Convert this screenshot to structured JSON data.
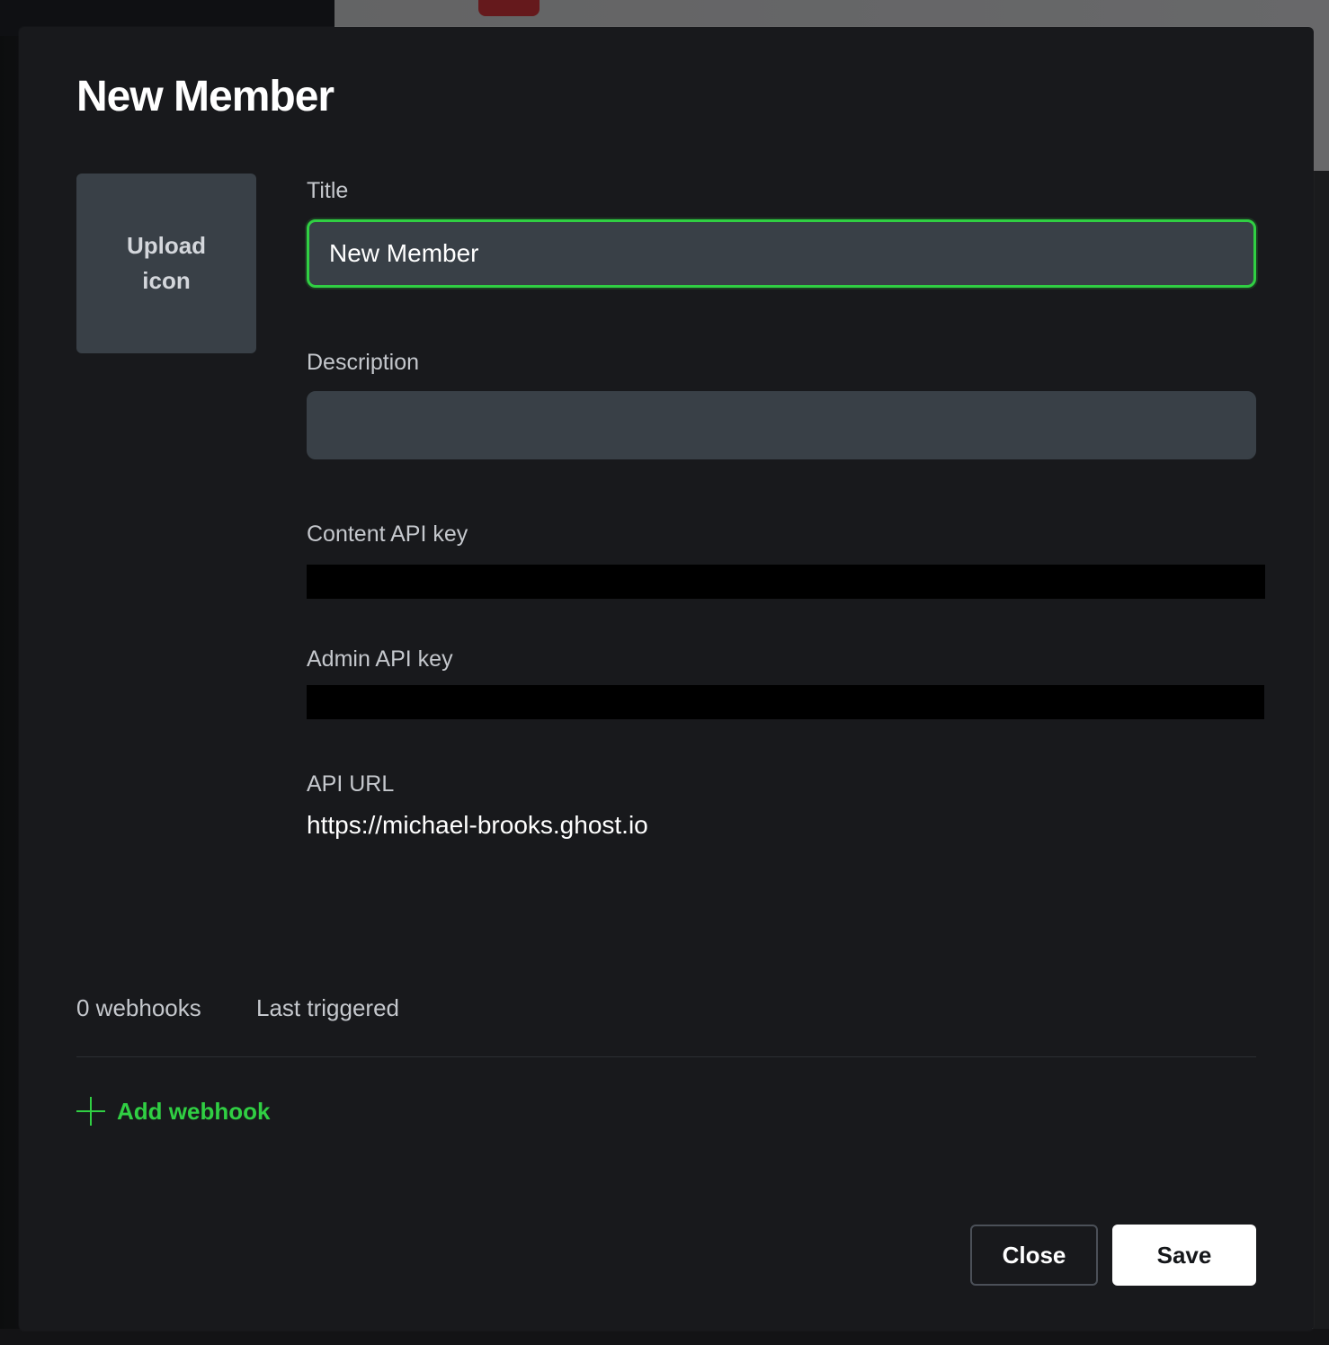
{
  "modal": {
    "title": "New Member",
    "upload_icon": {
      "line1": "Upload",
      "line2": "icon"
    },
    "fields": {
      "title": {
        "label": "Title",
        "value": "New Member"
      },
      "description": {
        "label": "Description",
        "value": ""
      },
      "content_api_key": {
        "label": "Content API key"
      },
      "admin_api_key": {
        "label": "Admin API key"
      },
      "api_url": {
        "label": "API URL",
        "value": "https://michael-brooks.ghost.io"
      }
    },
    "webhooks": {
      "count_label": "0 webhooks",
      "last_triggered_label": "Last triggered",
      "add_label": "Add webhook"
    },
    "buttons": {
      "close": "Close",
      "save": "Save"
    }
  },
  "colors": {
    "accent": "#30cf43",
    "modal_bg": "#18191c",
    "input_bg": "#394047"
  },
  "icons": {
    "add_webhook": "plus-icon"
  }
}
